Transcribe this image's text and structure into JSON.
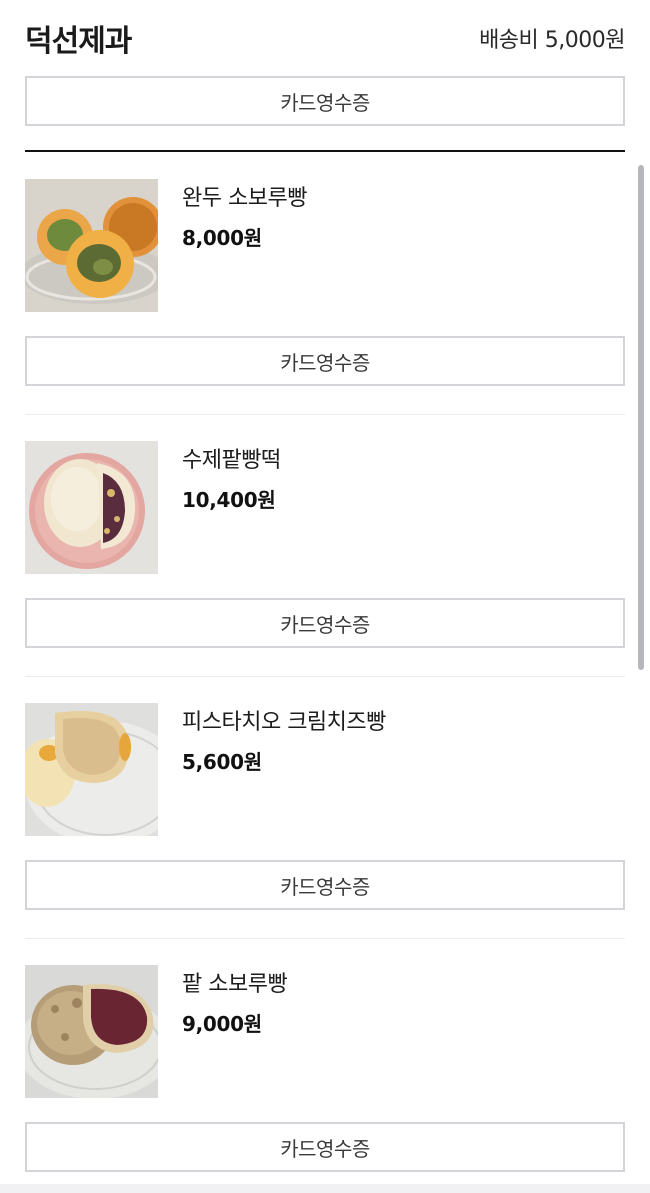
{
  "store": {
    "name": "덕선제과",
    "shipping_fee": "배송비 5,000원",
    "receipt_label": "카드영수증"
  },
  "items": [
    {
      "name": "완두 소보루빵",
      "price": "8,000원",
      "receipt_label": "카드영수증"
    },
    {
      "name": "수제팥빵떡",
      "price": "10,400원",
      "receipt_label": "카드영수증"
    },
    {
      "name": "피스타치오 크림치즈빵",
      "price": "5,600원",
      "receipt_label": "카드영수증"
    },
    {
      "name": "팥 소보루빵",
      "price": "9,000원",
      "receipt_label": "카드영수증"
    }
  ]
}
